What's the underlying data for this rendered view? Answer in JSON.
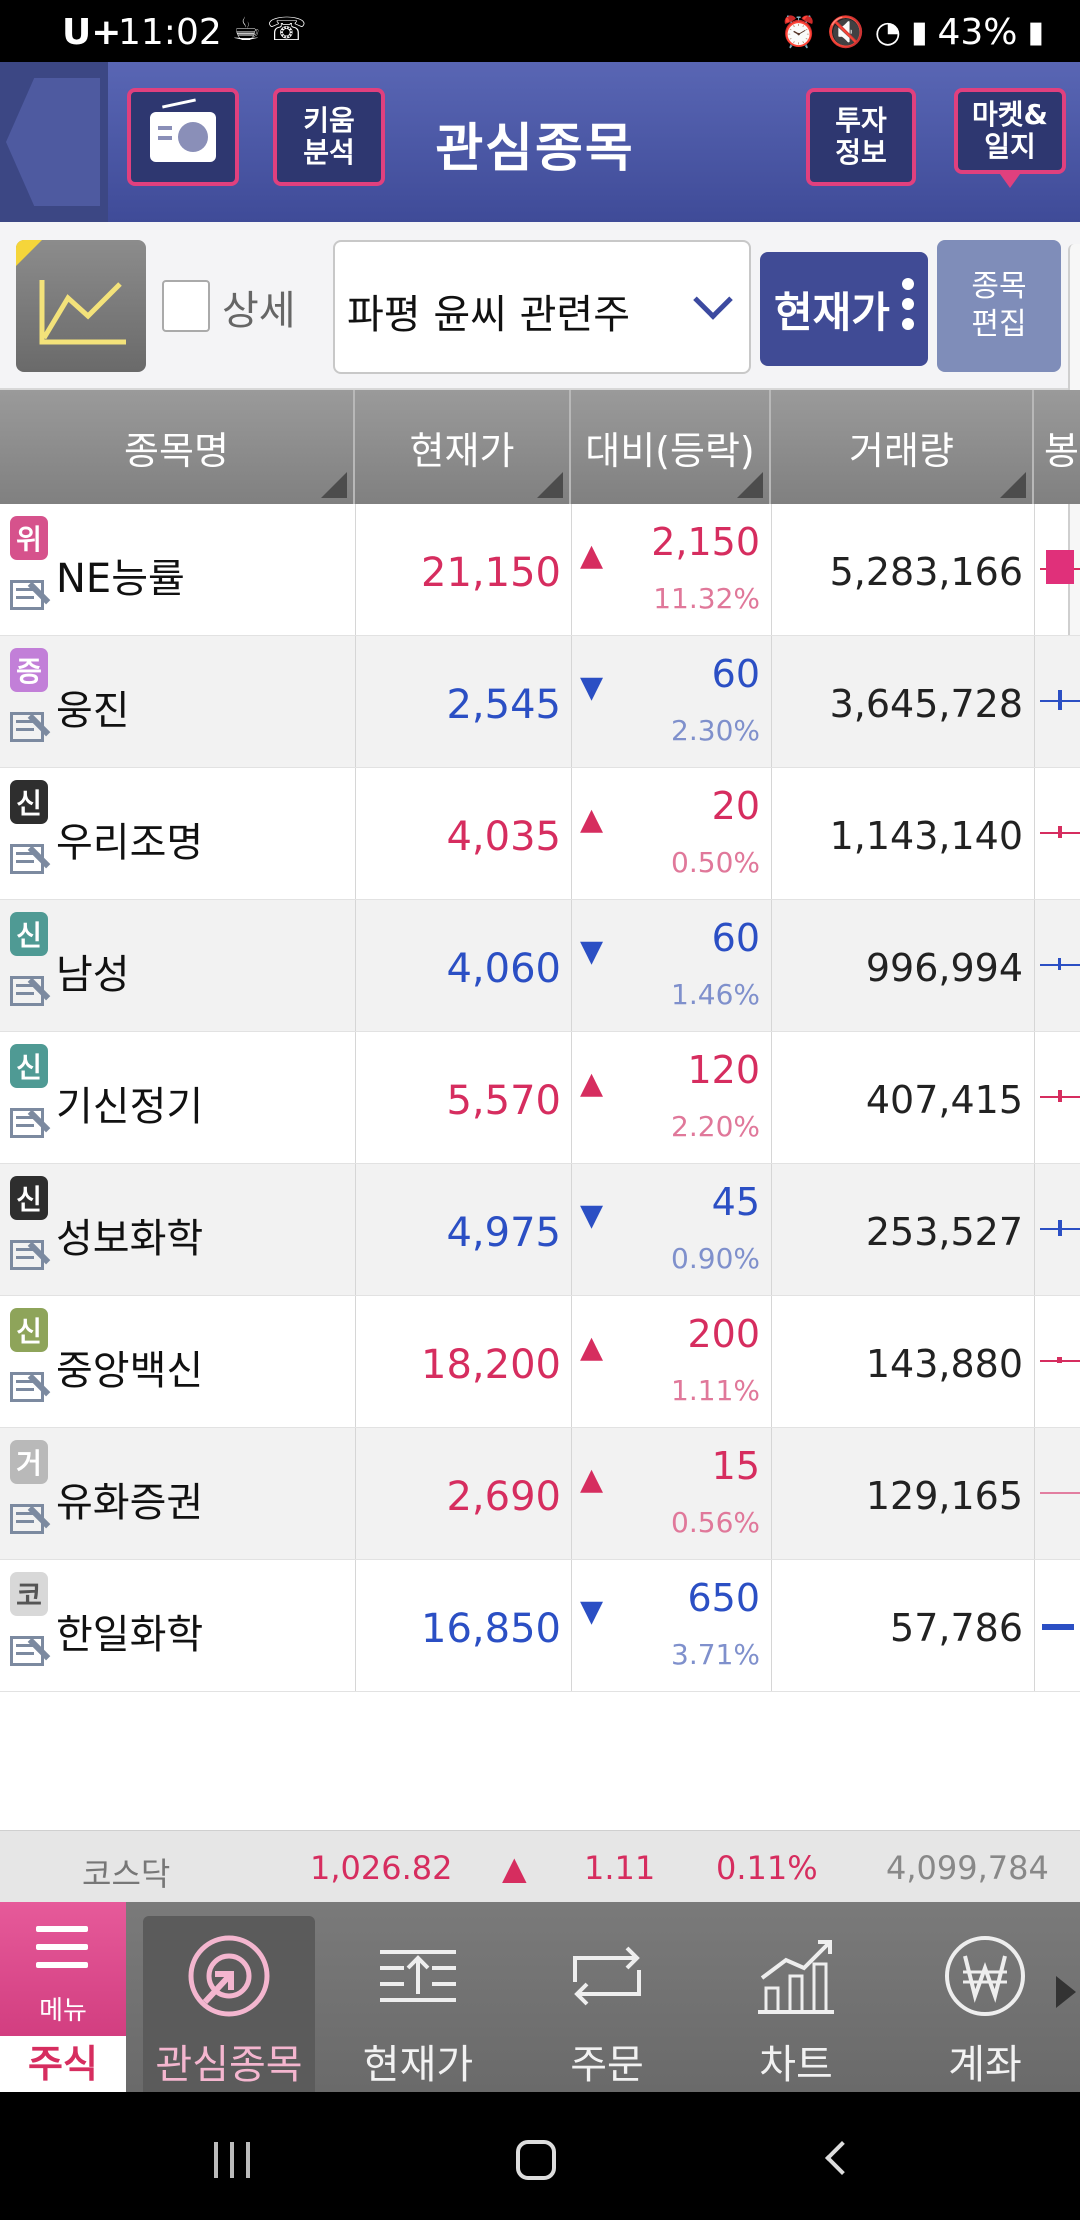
{
  "status_bar": {
    "carrier": "U+",
    "time": "11:02",
    "battery": "43%",
    "left_icons": [
      "coffee-icon",
      "missed-call-icon"
    ],
    "right_icons": [
      "alarm-icon",
      "mute-icon",
      "wifi-icon",
      "signal-icon",
      "battery-icon"
    ]
  },
  "header": {
    "title": "관심종목",
    "kiwoom_label": "키움\n분석",
    "invest_label": "투자\n정보",
    "market_label": "마켓&\n일지",
    "accent_color": "#e0407e"
  },
  "toolbar": {
    "detail_label": "상세",
    "group_select_value": "파평 윤씨 관련주",
    "price_button_label": "현재가",
    "edit_button_label": "종목\n편집"
  },
  "table": {
    "headers": {
      "name": "종목명",
      "price": "현재가",
      "change": "대비(등락)",
      "volume": "거래량",
      "bong": "봉"
    },
    "rows": [
      {
        "badge": "위",
        "name": "NE능률",
        "price": "21,150",
        "direction": "up",
        "change": "2,150",
        "pct": "11.32%",
        "volume": "5,283,166"
      },
      {
        "badge": "증",
        "name": "웅진",
        "price": "2,545",
        "direction": "down",
        "change": "60",
        "pct": "2.30%",
        "volume": "3,645,728"
      },
      {
        "badge": "신",
        "name": "우리조명",
        "price": "4,035",
        "direction": "up",
        "change": "20",
        "pct": "0.50%",
        "volume": "1,143,140"
      },
      {
        "badge": "신",
        "name": "남성",
        "price": "4,060",
        "direction": "down",
        "change": "60",
        "pct": "1.46%",
        "volume": "996,994"
      },
      {
        "badge": "신",
        "name": "기신정기",
        "price": "5,570",
        "direction": "up",
        "change": "120",
        "pct": "2.20%",
        "volume": "407,415"
      },
      {
        "badge": "신",
        "name": "성보화학",
        "price": "4,975",
        "direction": "down",
        "change": "45",
        "pct": "0.90%",
        "volume": "253,527"
      },
      {
        "badge": "신",
        "name": "중앙백신",
        "price": "18,200",
        "direction": "up",
        "change": "200",
        "pct": "1.11%",
        "volume": "143,880"
      },
      {
        "badge": "거",
        "name": "유화증권",
        "price": "2,690",
        "direction": "up",
        "change": "15",
        "pct": "0.56%",
        "volume": "129,165"
      },
      {
        "badge": "코",
        "name": "한일화학",
        "price": "16,850",
        "direction": "down",
        "change": "650",
        "pct": "3.71%",
        "volume": "57,786"
      }
    ],
    "up_color": "#d62d5f",
    "down_color": "#2b4fc4",
    "up_arrow": "▲",
    "down_arrow": "▼"
  },
  "index_strip": {
    "name": "코스닥",
    "value": "1,026.82",
    "arrow": "▲",
    "change": "1.11",
    "pct": "0.11%",
    "volume": "4,099,784"
  },
  "bottom_nav": {
    "menu_label": "메뉴",
    "stock_tab_label": "주식",
    "items": [
      {
        "label": "관심종목",
        "icon": "watchlist-icon",
        "active": true
      },
      {
        "label": "현재가",
        "icon": "current-price-icon",
        "active": false
      },
      {
        "label": "주문",
        "icon": "order-icon",
        "active": false
      },
      {
        "label": "차트",
        "icon": "chart-icon",
        "active": false
      },
      {
        "label": "계좌",
        "icon": "won-account-icon",
        "active": false
      }
    ]
  }
}
